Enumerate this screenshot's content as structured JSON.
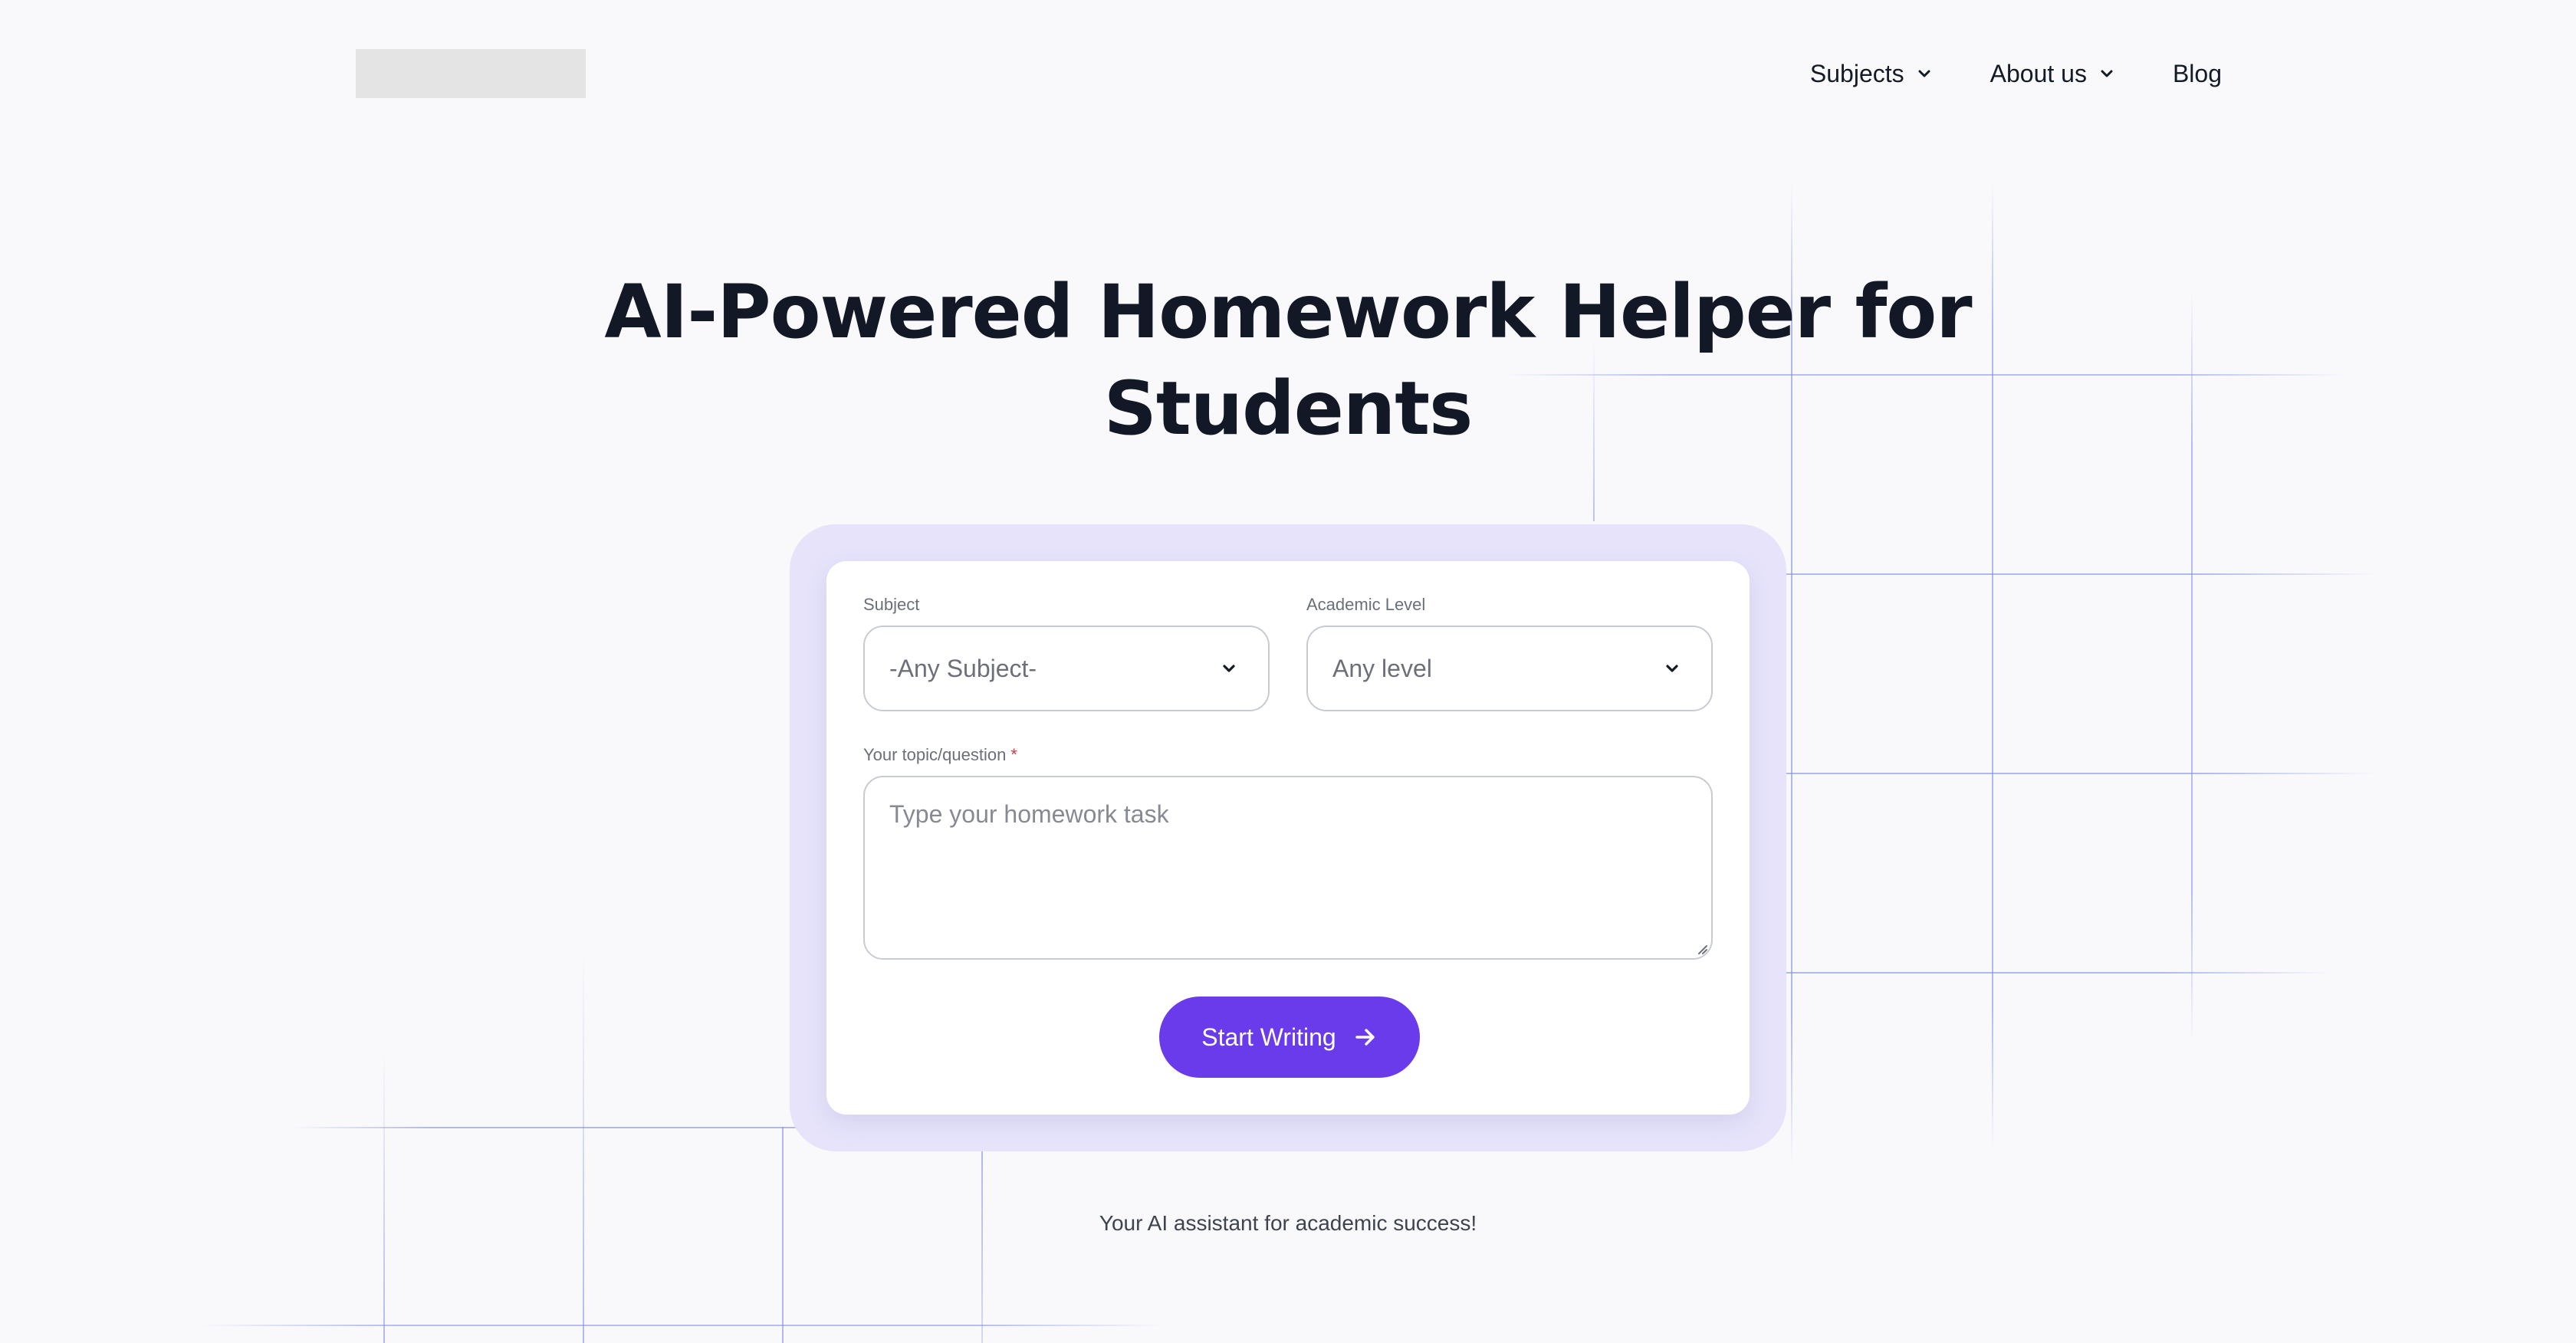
{
  "header": {
    "logo_alt": "",
    "nav": [
      {
        "label": "Subjects",
        "has_dropdown": true
      },
      {
        "label": "About us",
        "has_dropdown": true
      },
      {
        "label": "Blog",
        "has_dropdown": false
      }
    ]
  },
  "hero": {
    "title_line1": "AI-Powered Homework Helper for",
    "title_line2": "Students"
  },
  "form": {
    "subject": {
      "label": "Subject",
      "value": "-Any Subject-"
    },
    "level": {
      "label": "Academic Level",
      "value": "Any level"
    },
    "topic": {
      "label": "Your topic/question",
      "required_mark": "*",
      "placeholder": "Type your homework task"
    },
    "submit_label": "Start Writing"
  },
  "tagline": "Your AI assistant for academic success!",
  "colors": {
    "accent": "#6a3bea",
    "card_frame": "#e6e3fb",
    "background": "#f9f9fc",
    "grid_line": "#7f8fe0"
  },
  "icons": {
    "dropdown": "chevron-down-icon",
    "submit": "arrow-right-icon",
    "resize": "resize-handle-icon"
  }
}
